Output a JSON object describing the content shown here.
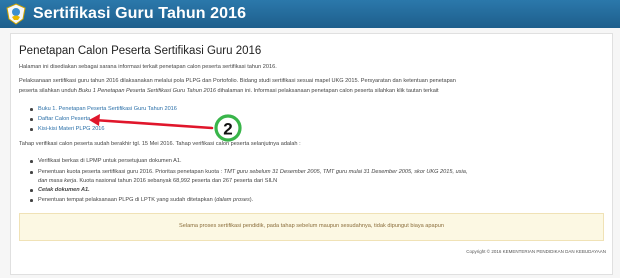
{
  "header": {
    "title": "Sertifikasi Guru Tahun 2016"
  },
  "main": {
    "heading": "Penetapan Calon Peserta Sertifikasi Guru 2016",
    "intro": "Halaman ini disediakan sebagai sarana informasi terkait penetapan calon peserta sertifikasi tahun 2016.",
    "para1_a": "Pelaksanaan sertifikasi guru tahun 2016 dilaksanakan melalui pola PLPG dan Portofolio. Bidang studi sertifikasi sesuai mapel UKG 2015. Persyaratan dan ketentuan penetapan",
    "para1_b": "peserta silahkan unduh ",
    "para1_b_italic": "Buku 1 Penetapan Peserta Sertifikasi Guru Tahun 2016",
    "para1_b_rest": " dihalaman ini. Informasi pelaksanaan penetapan calon peserta silahkan klik tautan terkait",
    "links": [
      "Buku 1. Penetapan Peserta Sertifikasi Guru Tahun 2016",
      "Daftar Calon Peserta",
      "Kisi-kisi Materi PLPG 2016"
    ],
    "para2": "Tahap verifikasi calon peserta sudah berakhir tgl. 15 Mei 2016. Tahap verifikasi calon peserta selanjutnya adalah :",
    "steps": {
      "s1": "Verifikasi berkas di LPMP untuk persetujuan dokumen A1.",
      "s2_a": "Penentuan kuota peserta sertifikasi guru 2016. Prioritas penetapan kuota : ",
      "s2_italic": "TMT guru sebelum 31 Desember 2005, TMT guru mulai 31 Desember 2005, skor UKG 2015, usia,",
      "s2_b_italic": "dan masa kerja",
      "s2_b": ". Kuota nasional tahun 2016 sebanyak 68,992 peserta dan 267 peserta dari SILN",
      "s3": "Cetak dokumen A1.",
      "s4_a": "Penentuan tempat pelaksanaan PLPG di LPTK yang sudah ditetapkan (",
      "s4_italic": "dalam proses",
      "s4_b": ")."
    },
    "notice": "Selama proses sertifikasi pendidik, pada tahap sebelum maupun sesudahnya, tidak dipungut biaya apapun",
    "copyright": "Copyright © 2016 KEMENTERIAN PENDIDIKAN DAN KEBUDAYAAN"
  },
  "annotation": {
    "number": "2",
    "circle_color": "#39b54a",
    "arrow_color": "#e0162b"
  },
  "colors": {
    "header": "#2470a3",
    "link": "#2a6fa8"
  },
  "icons": {
    "logo": "tut-wuri-handayani-logo"
  }
}
